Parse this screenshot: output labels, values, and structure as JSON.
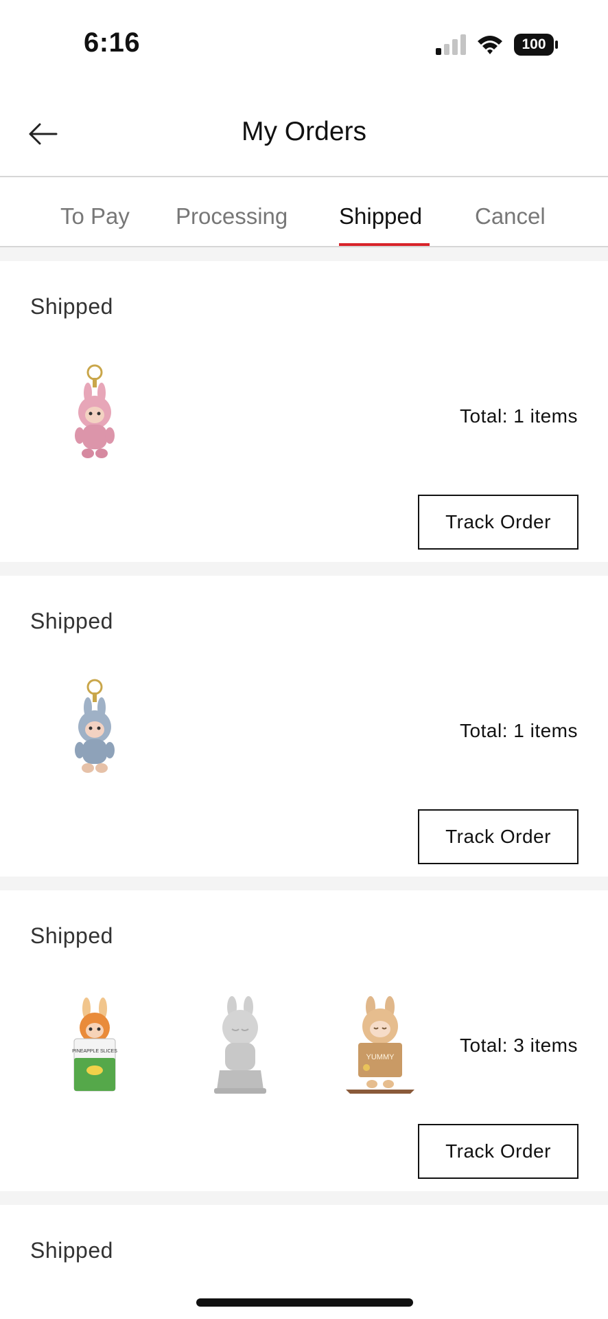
{
  "status_bar": {
    "time": "6:16",
    "battery": "100"
  },
  "header": {
    "title": "My Orders"
  },
  "tabs": [
    {
      "label": "To Pay",
      "active": false
    },
    {
      "label": "Processing",
      "active": false
    },
    {
      "label": "Shipped",
      "active": true
    },
    {
      "label": "Cancel",
      "active": false
    }
  ],
  "orders": [
    {
      "status": "Shipped",
      "total": "Total: 1 items",
      "track_label": "Track Order",
      "products": [
        "pink-bunny-keychain"
      ]
    },
    {
      "status": "Shipped",
      "total": "Total: 1 items",
      "track_label": "Track Order",
      "products": [
        "blue-bunny-keychain"
      ]
    },
    {
      "status": "Shipped",
      "total": "Total: 3 items",
      "track_label": "Track Order",
      "products": [
        "pineapple-can-figure",
        "gray-figure",
        "yummy-figure"
      ]
    },
    {
      "status": "Shipped"
    }
  ],
  "can_text": "PINEAPPLE SLICES",
  "sign_text": "YUMMY",
  "colors": {
    "accent": "#d8232a",
    "background": "#f4f4f4"
  }
}
